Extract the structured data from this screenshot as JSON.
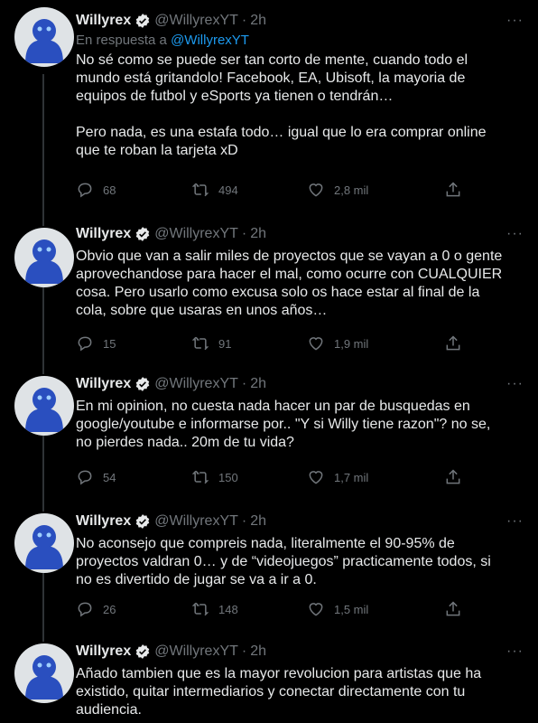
{
  "colors": {
    "background": "#000000",
    "text": "#e7e9ea",
    "muted": "#71767b",
    "link": "#1d9bf0",
    "verified": "#1d9bf0"
  },
  "reply_prefix": "En respuesta a ",
  "reply_handle": "@WillyrexYT",
  "tweets": [
    {
      "name": "Willyrex",
      "handle": "@WillyrexYT",
      "time": "2h",
      "text": "No sé como se puede ser tan corto de mente, cuando todo el\nmundo está gritandolo! Facebook, EA, Ubisoft, la mayoria de\nequipos de futbol y eSports ya tienen o tendrán…\n\nPero nada, es una estafa todo… igual que lo era comprar online\nque te roban la tarjeta xD",
      "replies": "68",
      "retweets": "494",
      "likes": "2,8 mil"
    },
    {
      "name": "Willyrex",
      "handle": "@WillyrexYT",
      "time": "2h",
      "text": "Obvio que van a salir miles de proyectos que se vayan a 0 o gente\naprovechandose para hacer el mal, como ocurre con CUALQUIER\ncosa. Pero usarlo como excusa solo os hace estar al final de la\ncola, sobre que usaras en unos años…",
      "replies": "15",
      "retweets": "91",
      "likes": "1,9 mil"
    },
    {
      "name": "Willyrex",
      "handle": "@WillyrexYT",
      "time": "2h",
      "text": "En mi opinion, no cuesta nada hacer un par de busquedas en\ngoogle/youtube e informarse por.. \"Y si Willy tiene razon\"? no se,\nno pierdes nada.. 20m de tu vida?",
      "replies": "54",
      "retweets": "150",
      "likes": "1,7 mil"
    },
    {
      "name": "Willyrex",
      "handle": "@WillyrexYT",
      "time": "2h",
      "text": "No aconsejo que compreis nada, literalmente el 90-95% de\nproyectos valdran 0… y de “videojuegos” practicamente todos, si\nno es divertido de jugar se va a ir a 0.",
      "replies": "26",
      "retweets": "148",
      "likes": "1,5 mil"
    },
    {
      "name": "Willyrex",
      "handle": "@WillyrexYT",
      "time": "2h",
      "text": "Añado tambien que es la mayor revolucion para artistas que ha\nexistido, quitar intermediarios y conectar directamente con tu\naudiencia."
    }
  ]
}
